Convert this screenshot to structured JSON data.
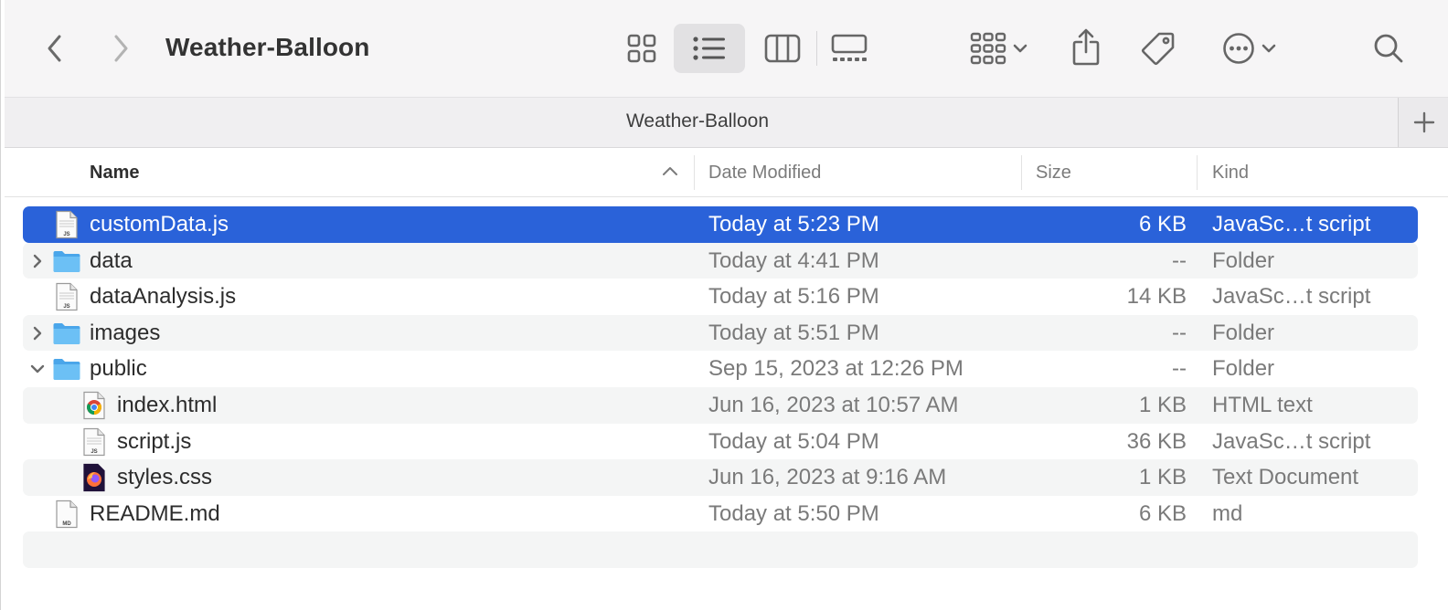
{
  "window": {
    "title": "Weather-Balloon"
  },
  "toolbar": {
    "back_icon": "chevron-left-icon",
    "forward_icon": "chevron-right-icon",
    "views": [
      "icon-view",
      "list-view",
      "column-view",
      "gallery-view"
    ],
    "active_view": "list-view",
    "group_icon": "group-by-icon",
    "share_icon": "share-icon",
    "tag_icon": "tag-icon",
    "more_icon": "ellipsis-icon",
    "search_icon": "search-icon"
  },
  "tabbar": {
    "tab_label": "Weather-Balloon",
    "add_label": "+"
  },
  "columns": {
    "name": "Name",
    "date": "Date Modified",
    "size": "Size",
    "kind": "Kind"
  },
  "colors": {
    "selection": "#2a62d9",
    "folder": "#5db3f0"
  },
  "rows": [
    {
      "name": "customData.js",
      "date": "Today at 5:23 PM",
      "size": "6 KB",
      "kind": "JavaSc…t script",
      "icon": "js-file-icon",
      "indent": 0,
      "disclosure": "none",
      "selected": true
    },
    {
      "name": "data",
      "date": "Today at 4:41 PM",
      "size": "--",
      "kind": "Folder",
      "icon": "folder-icon",
      "indent": 0,
      "disclosure": "collapsed",
      "selected": false
    },
    {
      "name": "dataAnalysis.js",
      "date": "Today at 5:16 PM",
      "size": "14 KB",
      "kind": "JavaSc…t script",
      "icon": "js-file-icon",
      "indent": 0,
      "disclosure": "none",
      "selected": false
    },
    {
      "name": "images",
      "date": "Today at 5:51 PM",
      "size": "--",
      "kind": "Folder",
      "icon": "folder-icon",
      "indent": 0,
      "disclosure": "collapsed",
      "selected": false
    },
    {
      "name": "public",
      "date": "Sep 15, 2023 at 12:26 PM",
      "size": "--",
      "kind": "Folder",
      "icon": "folder-icon",
      "indent": 0,
      "disclosure": "expanded",
      "selected": false
    },
    {
      "name": "index.html",
      "date": "Jun 16, 2023 at 10:57 AM",
      "size": "1 KB",
      "kind": "HTML text",
      "icon": "chrome-html-icon",
      "indent": 1,
      "disclosure": "none",
      "selected": false
    },
    {
      "name": "script.js",
      "date": "Today at 5:04 PM",
      "size": "36 KB",
      "kind": "JavaSc…t script",
      "icon": "js-file-icon",
      "indent": 1,
      "disclosure": "none",
      "selected": false
    },
    {
      "name": "styles.css",
      "date": "Jun 16, 2023 at 9:16 AM",
      "size": "1 KB",
      "kind": "Text Document",
      "icon": "firefox-doc-icon",
      "indent": 1,
      "disclosure": "none",
      "selected": false
    },
    {
      "name": "README.md",
      "date": "Today at 5:50 PM",
      "size": "6 KB",
      "kind": "md",
      "icon": "md-file-icon",
      "indent": 0,
      "disclosure": "none",
      "selected": false
    }
  ]
}
